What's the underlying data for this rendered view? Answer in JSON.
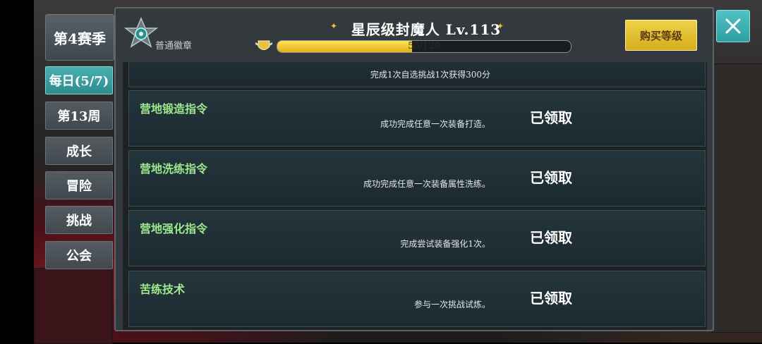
{
  "season": {
    "label": "第4赛季"
  },
  "tabs": [
    {
      "label": "每日(5/7)",
      "active": true
    },
    {
      "label": "第13周",
      "active": false
    },
    {
      "label": "成长",
      "active": false
    },
    {
      "label": "冒险",
      "active": false
    },
    {
      "label": "挑战",
      "active": false
    },
    {
      "label": "公会",
      "active": false
    }
  ],
  "header": {
    "badge_label": "普通徽章",
    "level_title": "星辰级封魔人 Lv.113",
    "xp": {
      "text": "55/120",
      "current": 55,
      "max": 120
    },
    "buy_label": "购买等级"
  },
  "partial_row_desc": "完成1次自选挑战1次获得300分",
  "tasks": [
    {
      "title": "营地锻造指令",
      "desc": "成功完成任意一次装备打造。",
      "status": "已领取"
    },
    {
      "title": "营地洗练指令",
      "desc": "成功完成任意一次装备属性洗练。",
      "status": "已领取"
    },
    {
      "title": "营地强化指令",
      "desc": "完成尝试装备强化1次。",
      "status": "已领取"
    },
    {
      "title": "苦练技术",
      "desc": "参与一次挑战试炼。",
      "status": "已领取"
    }
  ],
  "colors": {
    "accent": "#3aa6a8",
    "task_title": "#9ee88d",
    "xp_fill": "#f0c22a"
  }
}
